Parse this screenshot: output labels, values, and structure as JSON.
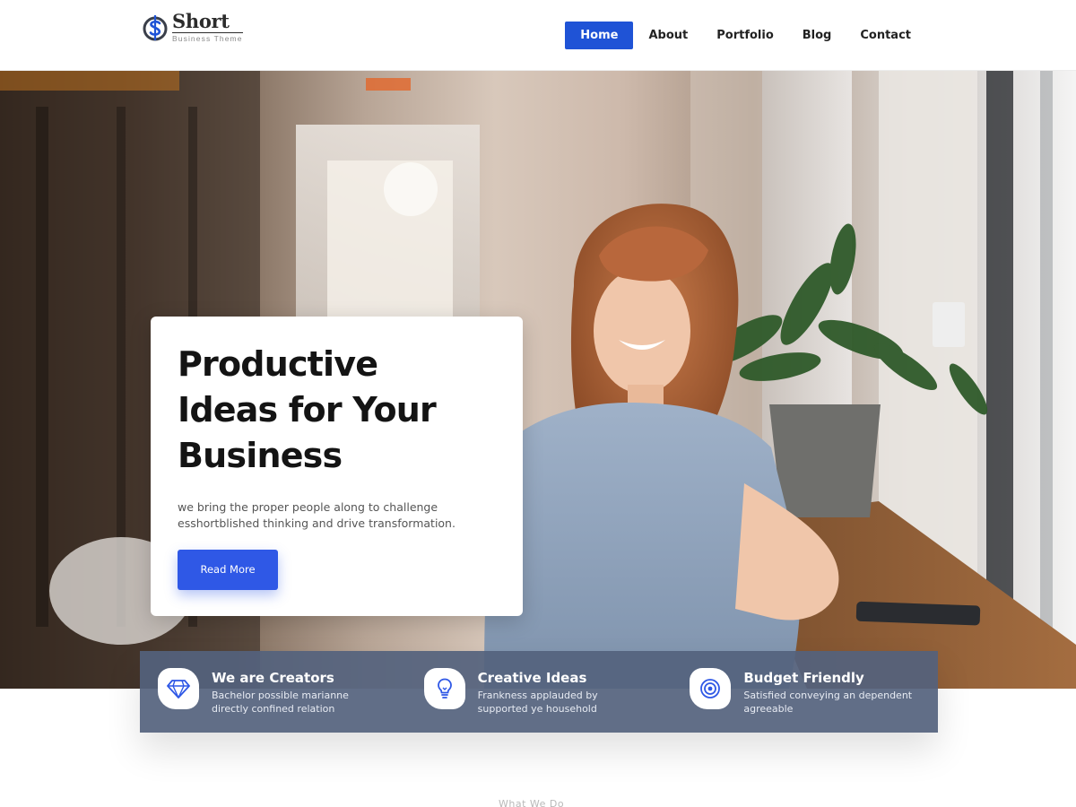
{
  "brand": {
    "name": "Short",
    "tagline": "Business Theme",
    "accent": "#1f53d6",
    "logo_icon": "dollar-circle-icon"
  },
  "nav": {
    "items": [
      {
        "label": "Home",
        "active": true
      },
      {
        "label": "About",
        "active": false
      },
      {
        "label": "Portfolio",
        "active": false
      },
      {
        "label": "Blog",
        "active": false
      },
      {
        "label": "Contact",
        "active": false
      }
    ]
  },
  "hero": {
    "title_lines": [
      "Productive",
      "Ideas for Your",
      "Business"
    ],
    "text": "we bring the proper people along to challenge esshortblished thinking and drive transformation.",
    "button_label": "Read More",
    "button_color": "#2f58e6"
  },
  "features": [
    {
      "icon": "diamond-icon",
      "title": "We are Creators",
      "desc_lines": [
        "Bachelor possible marianne",
        "directly confined relation"
      ]
    },
    {
      "icon": "lightbulb-icon",
      "title": "Creative Ideas",
      "desc_lines": [
        "Frankness applauded by",
        "supported ye household"
      ]
    },
    {
      "icon": "target-icon",
      "title": "Budget Friendly",
      "desc_lines": [
        "Satisfied conveying an dependent",
        "agreeable"
      ]
    }
  ],
  "section_hint": "What We Do"
}
